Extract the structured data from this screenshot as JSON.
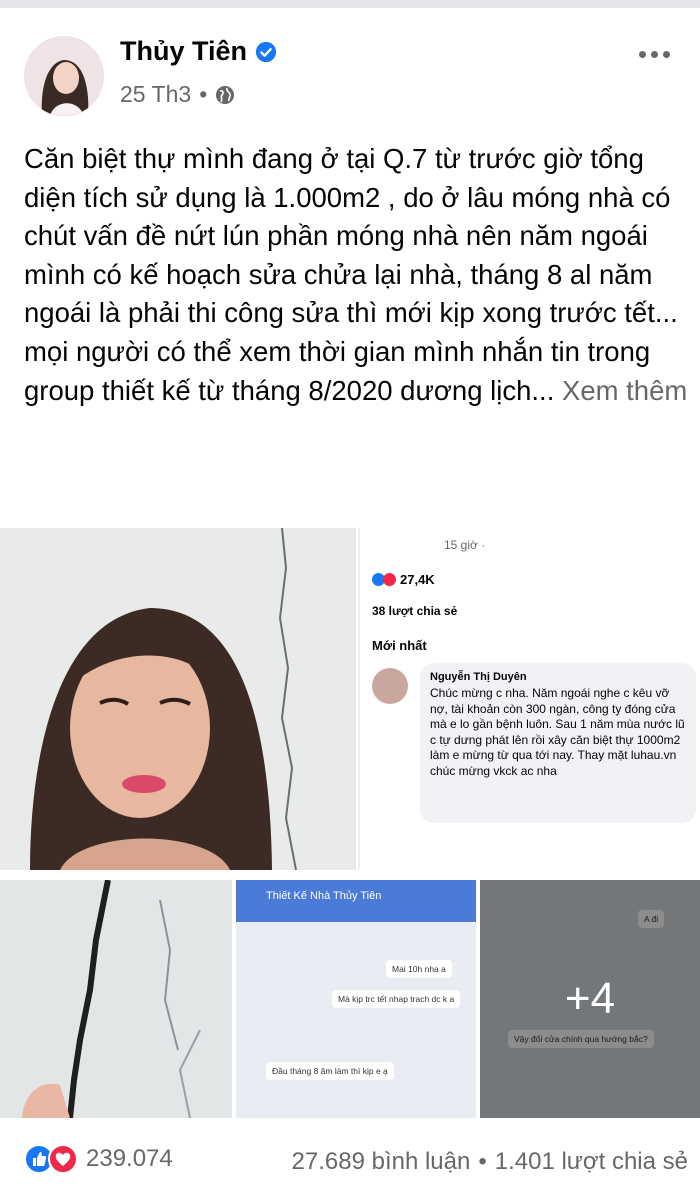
{
  "post": {
    "author": "Thủy Tiên",
    "timestamp": "25 Th3",
    "audience_icon": "globe-icon",
    "body_text": "Căn biệt thự mình đang ở tại Q.7 từ trước giờ tổng diện tích sử dụng là 1.000m2 , do ở lâu móng nhà có chút vấn đề nứt lún phần móng nhà nên năm ngoái mình có kế hoạch sửa chửa lại nhà, tháng 8 al năm ngoái là phải thi công sửa thì mới kịp xong trước tết... mọi người có thể xem thời gian mình nhắn tin trong group thiết kế từ tháng 8/2020 dương lịch...",
    "see_more": "Xem thêm"
  },
  "media": {
    "more_count": "+4",
    "screenshot": {
      "time": "15 giờ ·",
      "reactions": "27,4K",
      "shares": "38 lượt chia sẻ",
      "sort": "Mới nhất",
      "commenter": "Nguyễn Thị Duyên",
      "comment": "Chúc mừng c nha. Năm ngoái nghe c kêu vỡ nợ, tài khoản còn 300 ngàn, công ty đóng cửa mà e lo gần bệnh luôn. Sau 1 năm mùa nước lũ c tự dưng phát lên rồi xây căn biệt thự 1000m2 làm e mừng từ qua tới nay. Thay mặt luhau.vn chúc mừng vkck ac nha"
    },
    "chat": {
      "title": "Thiết Kế Nhà Thủy Tiên",
      "msg1": "Mai 10h nha a",
      "msg2": "Mà kịp trc tết nhap trach dc k a",
      "msg3": "Đầu tháng 8 âm làm thì kịp e ạ"
    },
    "chat2": {
      "msg1": "Vậy đổi cửa chính qua hướng bắc?",
      "msg2": "A đi"
    }
  },
  "footer": {
    "reaction_count": "239.074",
    "comments": "27.689 bình luận",
    "separator": "•",
    "shares": "1.401 lượt chia sẻ"
  },
  "colors": {
    "brand_blue": "#1877f2",
    "love_red": "#f0284a",
    "meta_gray": "#65676b"
  }
}
